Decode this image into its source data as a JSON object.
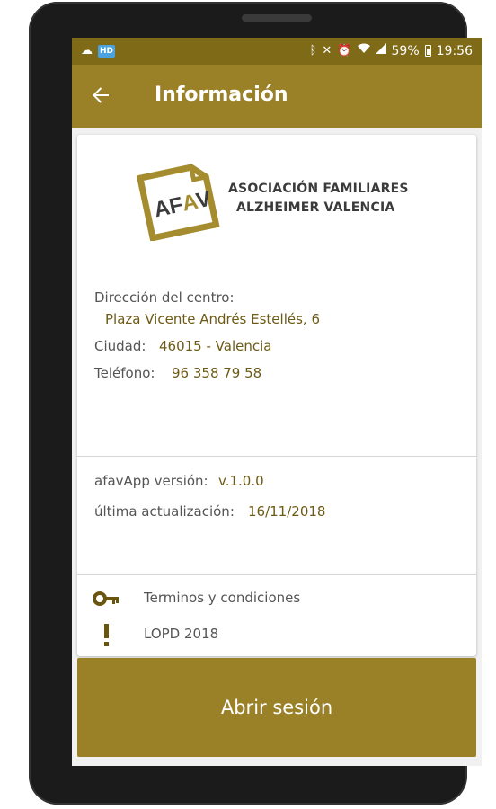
{
  "status_bar": {
    "battery": "59%",
    "time": "19:56",
    "left_icons": [
      "cloud-icon",
      "hd-icon"
    ],
    "right_icons": [
      "bluetooth-icon",
      "mute-icon",
      "alarm-icon",
      "wifi-icon",
      "signal-icon",
      "battery-icon"
    ]
  },
  "app_bar": {
    "title": "Información"
  },
  "logo": {
    "mark_text": "AFAV",
    "line1": "ASOCIACIÓN FAMILIARES",
    "line2": "ALZHEIMER VALENCIA"
  },
  "center": {
    "address_label": "Dirección del centro:",
    "address_value": "Plaza Vicente Andrés Estellés, 6",
    "city_label": "Ciudad:",
    "city_value": "46015 - Valencia",
    "phone_label": "Teléfono:",
    "phone_value": "96 358 79 58"
  },
  "app_info": {
    "version_label": "afavApp versión:",
    "version_value": "v.1.0.0",
    "updated_label": "última actualización:",
    "updated_value": "16/11/2018"
  },
  "links": [
    {
      "label": "Terminos y condiciones",
      "icon": "key-icon"
    },
    {
      "label": "LOPD 2018",
      "icon": "exclamation-icon"
    }
  ],
  "login_button": "Abrir sesión",
  "colors": {
    "primary": "#9a8128",
    "status_bar": "#7f6a18",
    "value_text": "#6d5a14"
  }
}
